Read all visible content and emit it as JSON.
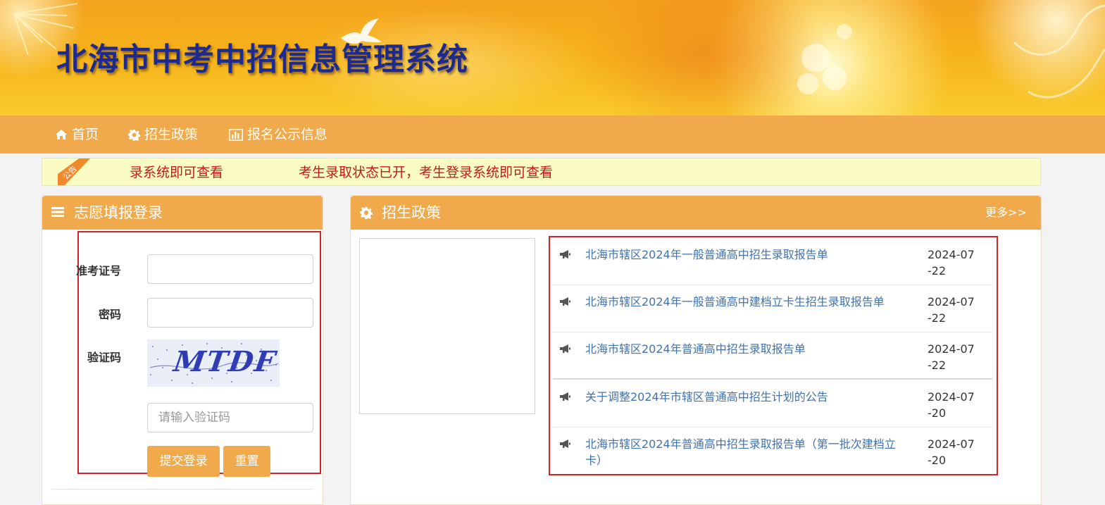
{
  "header": {
    "title": "北海市中考中招信息管理系统"
  },
  "nav": {
    "items": [
      {
        "label": "首页",
        "icon": "home-icon"
      },
      {
        "label": "招生政策",
        "icon": "gear-icon"
      },
      {
        "label": "报名公示信息",
        "icon": "bar-chart-icon"
      }
    ]
  },
  "notice": {
    "tag": "公告",
    "text_partial": "录系统即可查看",
    "text_full": "考生录取状态已开，考生登录系统即可查看"
  },
  "login_panel": {
    "title": "志愿填报登录",
    "ticket_label": "准考证号",
    "password_label": "密码",
    "captcha_label": "验证码",
    "captcha_image_text": "MTDF",
    "captcha_placeholder": "请输入验证码",
    "submit_label": "提交登录",
    "reset_label": "重置"
  },
  "policy_panel": {
    "title": "招生政策",
    "more_label": "更多>>",
    "items": [
      {
        "title": "北海市辖区2024年一般普通高中招生录取报告单",
        "date": "2024-07-22"
      },
      {
        "title": "北海市辖区2024年一般普通高中建档立卡生招生录取报告单",
        "date": "2024-07-22"
      },
      {
        "title": "北海市辖区2024年普通高中招生录取报告单",
        "date": "2024-07-22"
      },
      {
        "title": "关于调整2024年市辖区普通高中招生计划的公告",
        "date": "2024-07-20"
      },
      {
        "title": "北海市辖区2024年普通高中招生录取报告单（第一批次建档立卡）",
        "date": "2024-07-20"
      }
    ]
  },
  "colors": {
    "accent": "#f0aa4c",
    "notice_text": "#c81717",
    "link": "#3f72ae",
    "highlight_box": "#d2232a"
  }
}
